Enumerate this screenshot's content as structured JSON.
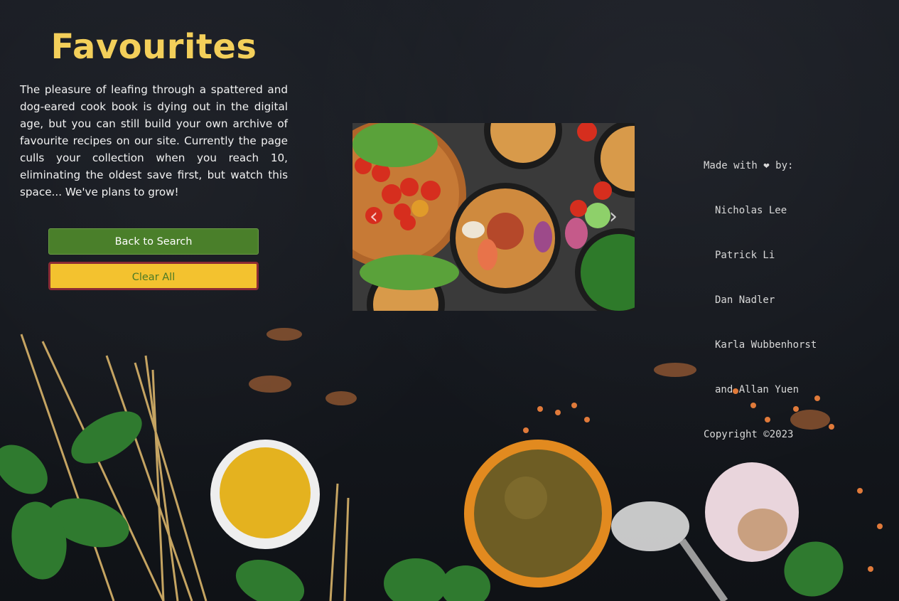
{
  "page": {
    "title": "Favourites",
    "intro": "The pleasure of leafing through a spattered and dog-eared cook book is dying out in the digital age, but you can still build your own archive of favourite recipes on our site. Currently the page culls your collection when you reach 10, eliminating the oldest save first, but watch this space... We've plans to grow!"
  },
  "buttons": {
    "back_label": "Back to Search",
    "clear_label": "Clear All"
  },
  "carousel": {
    "prev_icon": "chevron-left-icon",
    "next_icon": "chevron-right-icon"
  },
  "credits": {
    "made_with": "Made with ❤ by:",
    "authors": [
      "Nicholas Lee",
      "Patrick Li",
      "Dan Nadler",
      "Karla Wubbenhorst",
      "and Allan Yuen"
    ],
    "copyright": "Copyright ©2023"
  },
  "colors": {
    "title": "#f3cf5a",
    "back_button": "#4a7f2a",
    "clear_button": "#f3c22f",
    "clear_border": "#8b2b33"
  }
}
